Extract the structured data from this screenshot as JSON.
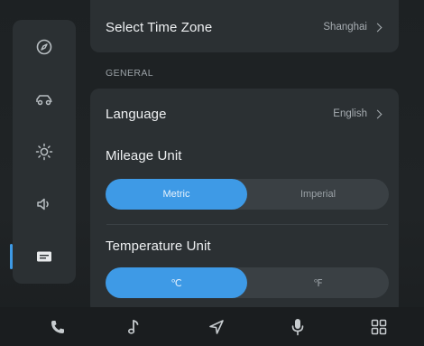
{
  "settings": {
    "time_zone": {
      "label": "Select Time Zone",
      "value": "Shanghai"
    },
    "general_header": "GENERAL",
    "language": {
      "label": "Language",
      "value": "English"
    },
    "mileage_unit": {
      "label": "Mileage Unit",
      "options": [
        "Metric",
        "Imperial"
      ],
      "selected": "Metric"
    },
    "temperature_unit": {
      "label": "Temperature Unit",
      "options": [
        "℃",
        "℉"
      ],
      "selected": "℃"
    }
  },
  "side_rail": {
    "items": [
      {
        "icon": "compass-icon",
        "active": false
      },
      {
        "icon": "car-icon",
        "active": false
      },
      {
        "icon": "brightness-icon",
        "active": false
      },
      {
        "icon": "speaker-icon",
        "active": false
      },
      {
        "icon": "settings-card-icon",
        "active": true
      }
    ]
  },
  "dock": {
    "items": [
      "phone-icon",
      "music-icon",
      "navigation-icon",
      "microphone-icon",
      "apps-grid-icon"
    ]
  },
  "colors": {
    "accent": "#3e9ae6",
    "card": "#2b3033",
    "background": "#1d2123"
  }
}
